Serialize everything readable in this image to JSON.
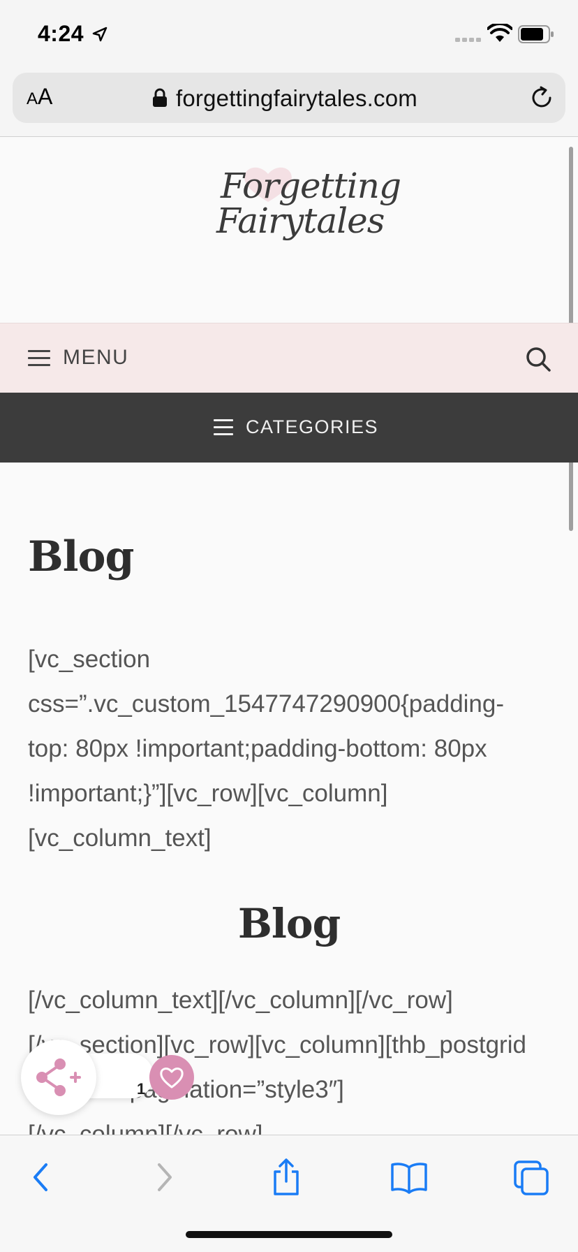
{
  "status_bar": {
    "time": "4:24"
  },
  "browser": {
    "text_size_small": "A",
    "text_size_large": "A",
    "url": "forgettingfairytales.com"
  },
  "site": {
    "logo_line1": "Forgetting",
    "logo_line2": "Fairytales",
    "menu_label": "MENU",
    "categories_label": "CATEGORIES"
  },
  "content": {
    "page_title": "Blog",
    "shortcode_lines_1": [
      "[vc_section",
      "css=”.vc_custom_1547747290900{padding-",
      "top: 80px !important;padding-bottom: 80px",
      "!important;}”][vc_row][vc_column]",
      "[vc_column_text]"
    ],
    "blog_heading": "Blog",
    "shortcode_lines_2": [
      "[/vc_column_text][/vc_column][/vc_row]",
      "[/vc_section][vc_row][vc_column][thb_postgrid",
      "style=”4″ pagination=”style3″]",
      "[/vc_column][/vc_row]"
    ]
  },
  "share_widget": {
    "count": "1"
  },
  "colors": {
    "menu_bar_bg": "#f6e9e9",
    "categories_bar_bg": "#3c3c3c",
    "share_accent": "#d98fb3",
    "ios_blue": "#1a7cf5"
  },
  "icons": {
    "location": "location-arrow-icon",
    "signal": "cellular-signal-icon",
    "wifi": "wifi-icon",
    "battery": "battery-icon",
    "lock": "lock-icon",
    "reload": "reload-icon",
    "hamburger": "hamburger-icon",
    "search": "search-icon",
    "share": "share-nodes-icon",
    "heart": "heart-icon",
    "back": "chevron-left-icon",
    "forward": "chevron-right-icon",
    "share_sheet": "share-sheet-icon",
    "bookmarks": "book-icon",
    "tabs": "tabs-icon"
  }
}
